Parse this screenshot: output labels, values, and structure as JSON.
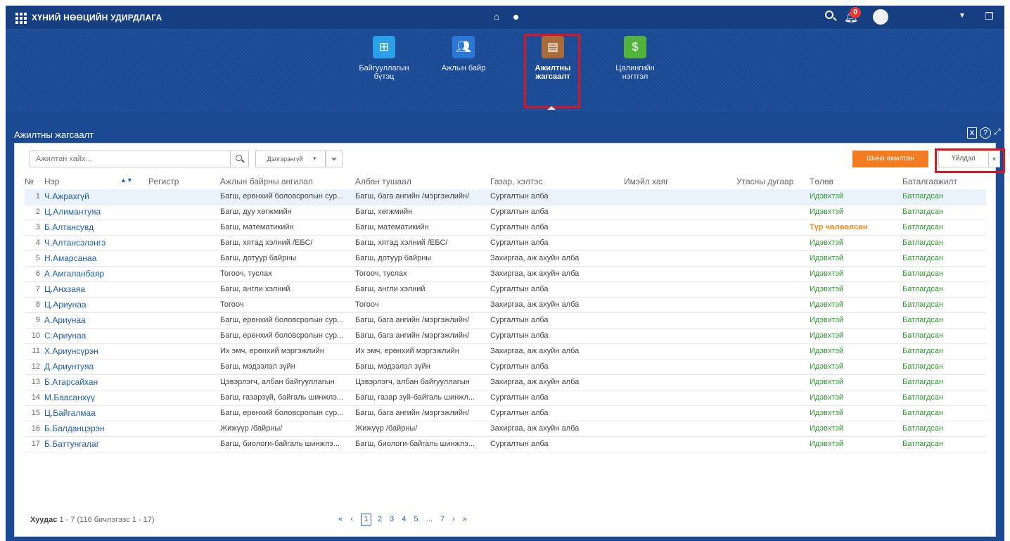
{
  "topbar": {
    "title": "ХҮНИЙ НӨӨЦИЙН УДИРДЛАГА",
    "notif_count": "0"
  },
  "modules": [
    {
      "label": "Байгууллагын бүтэц",
      "color": "#2b9fe8"
    },
    {
      "label": "Ажлын байр",
      "color": "#2a77d6"
    },
    {
      "label": "Ажилтны жагсаалт",
      "color": "#a86b3a"
    },
    {
      "label": "Цалингийн нэгтгэл",
      "color": "#4fb33c"
    }
  ],
  "panel": {
    "title": "Ажилтны жагсаалт",
    "excel_icon": "X",
    "help_icon": "?"
  },
  "toolbar": {
    "search_placeholder": "Ажилтан хайх...",
    "advanced_label": "Дэлгэрэнгүй",
    "new_button": "Шинэ ажилтан",
    "action_button": "Үйлдэл"
  },
  "columns": {
    "num": "№",
    "name": "Нэр",
    "register": "Регистр",
    "position_category": "Ажлын байрны ангилал",
    "job_title": "Албан тушаал",
    "department": "Газар, хэлтэс",
    "email": "Имэйл хаяг",
    "phone": "Утасны дугаар",
    "status": "Төлөв",
    "confirmation": "Баталгаажилт"
  },
  "rows": [
    {
      "num": "1",
      "name": "Ч.Ажрахгүй",
      "cat": "Багш, ерөнхий боловсролын сур...",
      "title": "Багш, бага ангийн /мэргэжлийн/",
      "dept": "Сургалтын алба",
      "status": "Идэвхтэй",
      "conf": "Батлагдсан"
    },
    {
      "num": "2",
      "name": "Ц.Алимантуяа",
      "cat": "Багш, дуу хөгжмийн",
      "title": "Багш, хөгжмийн",
      "dept": "Сургалтын алба",
      "status": "Идэвхтэй",
      "conf": "Батлагдсан"
    },
    {
      "num": "3",
      "name": "Б.Алтансувд",
      "cat": "Багш, математикийн",
      "title": "Багш, математикийн",
      "dept": "Сургалтын алба",
      "status": "Түр чөлөөлсөн",
      "conf": "Батлагдсан"
    },
    {
      "num": "4",
      "name": "Ч.Алтансэлэнгэ",
      "cat": "Багш, хятад хэлний /ЕБС/",
      "title": "Багш, хятад хэлний /ЕБС/",
      "dept": "Сургалтын алба",
      "status": "Идэвхтэй",
      "conf": "Батлагдсан"
    },
    {
      "num": "5",
      "name": "Н.Амарсанаа",
      "cat": "Багш, дотуур байрны",
      "title": "Багш, дотуур байрны",
      "dept": "Захиргаа, аж ахуйн алба",
      "status": "Идэвхтэй",
      "conf": "Батлагдсан"
    },
    {
      "num": "6",
      "name": "А.Амгаланбаяр",
      "cat": "Тогооч, туслах",
      "title": "Тогооч, туслах",
      "dept": "Захиргаа, аж ахуйн алба",
      "status": "Идэвхтэй",
      "conf": "Батлагдсан"
    },
    {
      "num": "7",
      "name": "Ц.Анхзаяа",
      "cat": "Багш, англи хэлний",
      "title": "Багш, англи хэлний",
      "dept": "Сургалтын алба",
      "status": "Идэвхтэй",
      "conf": "Батлагдсан"
    },
    {
      "num": "8",
      "name": "Ц.Ариунаа",
      "cat": "Тогооч",
      "title": "Тогооч",
      "dept": "Захиргаа, аж ахуйн алба",
      "status": "Идэвхтэй",
      "conf": "Батлагдсан"
    },
    {
      "num": "9",
      "name": "А.Ариунаа",
      "cat": "Багш, ерөнхий боловсролын сур...",
      "title": "Багш, бага ангийн /мэргэжлийн/",
      "dept": "Сургалтын алба",
      "status": "Идэвхтэй",
      "conf": "Батлагдсан"
    },
    {
      "num": "10",
      "name": "С.Ариунаа",
      "cat": "Багш, ерөнхий боловсролын сур...",
      "title": "Багш, бага ангийн /мэргэжлийн/",
      "dept": "Сургалтын алба",
      "status": "Идэвхтэй",
      "conf": "Батлагдсан"
    },
    {
      "num": "11",
      "name": "Х.Ариунсүрэн",
      "cat": "Их эмч, ерөнхий мэргэжлийн",
      "title": "Их эмч, ерөнхий мэргэжлийн",
      "dept": "Захиргаа, аж ахуйн алба",
      "status": "Идэвхтэй",
      "conf": "Батлагдсан"
    },
    {
      "num": "12",
      "name": "Д.Ариунтуяа",
      "cat": "Багш, мэдээлэл зүйн",
      "title": "Багш, мэдээлэл зүйн",
      "dept": "Сургалтын алба",
      "status": "Идэвхтэй",
      "conf": "Батлагдсан"
    },
    {
      "num": "13",
      "name": "Б.Атарсайхан",
      "cat": "Цэвэрлэгч, албан байгууллагын",
      "title": "Цэвэрлэгч, албан байгууллагын",
      "dept": "Захиргаа, аж ахуйн алба",
      "status": "Идэвхтэй",
      "conf": "Батлагдсан"
    },
    {
      "num": "14",
      "name": "М.Баасанхүү",
      "cat": "Багш, газарзүй, байгаль шинжлэ...",
      "title": "Багш, газар зүй-байгаль шинжл...",
      "dept": "Сургалтын алба",
      "status": "Идэвхтэй",
      "conf": "Батлагдсан"
    },
    {
      "num": "15",
      "name": "Ц.Байгалмаа",
      "cat": "Багш, ерөнхий боловсролын сур...",
      "title": "Багш, бага ангийн /мэргэжлийн/",
      "dept": "Сургалтын алба",
      "status": "Идэвхтэй",
      "conf": "Батлагдсан"
    },
    {
      "num": "16",
      "name": "Б.Балданцэрэн",
      "cat": "Жижүүр /байрны/",
      "title": "Жижүүр /байрны/",
      "dept": "Захиргаа, аж ахуйн алба",
      "status": "Идэвхтэй",
      "conf": "Батлагдсан"
    },
    {
      "num": "17",
      "name": "Б.Баттунгалаг",
      "cat": "Багш, биологи-байгаль шинжлэ...",
      "title": "Багш, биологи-байгаль шинжлэ...",
      "dept": "Сургалтын алба",
      "status": "Идэвхтэй",
      "conf": "Батлагдсан"
    }
  ],
  "footer": {
    "page_label": "Хуудас",
    "page_info": "1 - 7 (116 бичлэгээс 1 - 17)"
  },
  "pager": {
    "first": "«",
    "prev": "‹",
    "pages": [
      "1",
      "2",
      "3",
      "4",
      "5",
      "...",
      "7"
    ],
    "next": "›",
    "last": "»"
  },
  "colors": {
    "header_blue": "#1b4a93",
    "accent_orange": "#f47c20",
    "active_green": "#2e9b2e",
    "temp_orange": "#f08a24",
    "highlight_red": "#e0141c"
  }
}
